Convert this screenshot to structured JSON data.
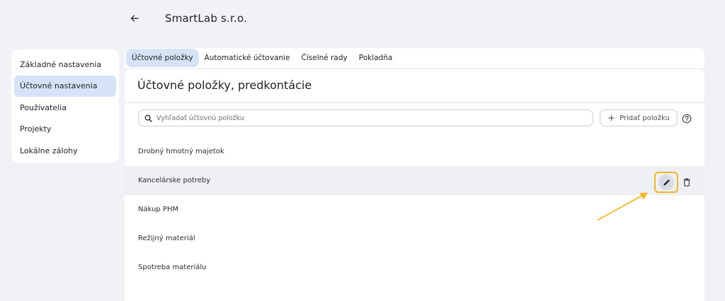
{
  "header": {
    "back_icon": "arrow-left-icon",
    "company_name": "SmartLab s.r.o."
  },
  "sidebar": {
    "items": [
      {
        "label": "Základné nastavenia",
        "active": false
      },
      {
        "label": "Účtovné nastavenia",
        "active": true
      },
      {
        "label": "Používatelia",
        "active": false
      },
      {
        "label": "Projekty",
        "active": false
      },
      {
        "label": "Lokálne zálohy",
        "active": false
      }
    ]
  },
  "tabs": [
    {
      "label": "Účtovné položky",
      "active": true
    },
    {
      "label": "Automatické účtovanie",
      "active": false
    },
    {
      "label": "Číselné rady",
      "active": false
    },
    {
      "label": "Pokladňa",
      "active": false
    }
  ],
  "main": {
    "title": "Účtovné položky, predkontácie",
    "search": {
      "placeholder": "Vyhľadať účtovnú položku",
      "value": ""
    },
    "add_button_label": "Pridať položku",
    "items": [
      {
        "label": "Drobný hmotný majetok"
      },
      {
        "label": "Kancelárske potreby",
        "hovered": true
      },
      {
        "label": "Nákup PHM"
      },
      {
        "label": "Režijný materiál"
      },
      {
        "label": "Spotreba materiálu"
      }
    ]
  },
  "colors": {
    "background": "#f1f2f6",
    "active_item": "#d6e3f7",
    "highlight": "#f5b722",
    "hover_row": "#eef0f4"
  }
}
